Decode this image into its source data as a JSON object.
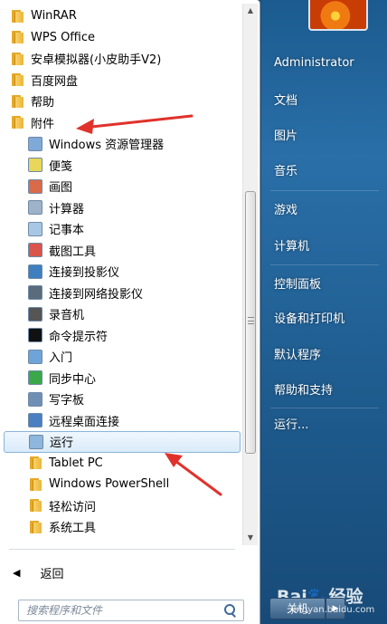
{
  "programs": {
    "top_items": [
      {
        "label": "WinRAR"
      },
      {
        "label": "WPS Office"
      },
      {
        "label": "安卓模拟器(小皮助手V2)"
      },
      {
        "label": "百度网盘"
      },
      {
        "label": "帮助"
      },
      {
        "label": "附件"
      }
    ],
    "accessories": [
      {
        "label": "Windows 资源管理器",
        "icon": "explorer-icon",
        "color": "#7fa9d6"
      },
      {
        "label": "便笺",
        "icon": "sticky-notes-icon",
        "color": "#e8d75a"
      },
      {
        "label": "画图",
        "icon": "paint-icon",
        "color": "#d96b4a"
      },
      {
        "label": "计算器",
        "icon": "calculator-icon",
        "color": "#9fb3c8"
      },
      {
        "label": "记事本",
        "icon": "notepad-icon",
        "color": "#a7c7e4"
      },
      {
        "label": "截图工具",
        "icon": "snipping-tool-icon",
        "color": "#d9544a"
      },
      {
        "label": "连接到投影仪",
        "icon": "projector-icon",
        "color": "#3f7fc0"
      },
      {
        "label": "连接到网络投影仪",
        "icon": "network-projector-icon",
        "color": "#5a6b7c"
      },
      {
        "label": "录音机",
        "icon": "sound-recorder-icon",
        "color": "#555555"
      },
      {
        "label": "命令提示符",
        "icon": "command-prompt-icon",
        "color": "#111111"
      },
      {
        "label": "入门",
        "icon": "getting-started-icon",
        "color": "#6fa4d8"
      },
      {
        "label": "同步中心",
        "icon": "sync-center-icon",
        "color": "#3aa84a"
      },
      {
        "label": "写字板",
        "icon": "wordpad-icon",
        "color": "#6f8fb5"
      },
      {
        "label": "远程桌面连接",
        "icon": "remote-desktop-icon",
        "color": "#4a7fc0"
      },
      {
        "label": "运行",
        "icon": "run-icon",
        "color": "#8fb6dc",
        "selected": true
      }
    ],
    "folders": [
      {
        "label": "Tablet PC"
      },
      {
        "label": "Windows PowerShell"
      },
      {
        "label": "轻松访问"
      },
      {
        "label": "系统工具"
      }
    ],
    "back_label": "返回"
  },
  "search": {
    "placeholder": "搜索程序和文件"
  },
  "right_panel": {
    "user": "Administrator",
    "items": [
      "文档",
      "图片",
      "音乐",
      "游戏",
      "计算机",
      "控制面板",
      "设备和打印机",
      "默认程序",
      "帮助和支持",
      "运行..."
    ]
  },
  "shutdown": {
    "label": "关机",
    "arrow": "▶"
  },
  "watermark": {
    "text": "Bai🐾经验",
    "sub": "jingyan.baidu.com"
  },
  "colors": {
    "right_bg": "#1f5d90",
    "annotation": "#e0322b",
    "selected_border": "#8ab4d9"
  }
}
